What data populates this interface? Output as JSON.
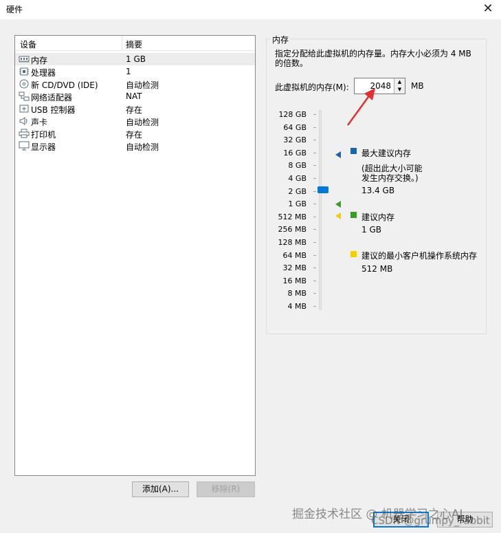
{
  "window": {
    "title": "硬件",
    "close_glyph": "✕"
  },
  "device_list": {
    "headers": [
      "设备",
      "摘要"
    ],
    "rows": [
      {
        "icon": "memory-icon",
        "name": "内存",
        "summary": "1 GB"
      },
      {
        "icon": "processor-icon",
        "name": "处理器",
        "summary": "1"
      },
      {
        "icon": "cd-dvd-icon",
        "name": "新 CD/DVD (IDE)",
        "summary": "自动检测"
      },
      {
        "icon": "network-adapter-icon",
        "name": "网络适配器",
        "summary": "NAT"
      },
      {
        "icon": "usb-icon",
        "name": "USB 控制器",
        "summary": "存在"
      },
      {
        "icon": "sound-card-icon",
        "name": "声卡",
        "summary": "自动检测"
      },
      {
        "icon": "printer-icon",
        "name": "打印机",
        "summary": "存在"
      },
      {
        "icon": "display-icon",
        "name": "显示器",
        "summary": "自动检测"
      }
    ],
    "selected_index": 0
  },
  "buttons": {
    "add": "添加(A)...",
    "remove": "移除(R)",
    "close": "关闭",
    "help": "帮助"
  },
  "memory": {
    "group_title": "内存",
    "description": "指定分配给此虚拟机的内存量。内存大小必须为 4 MB 的倍数。",
    "field_label": "此虚拟机的内存(M):",
    "value": "2048",
    "unit": "MB",
    "scale": [
      "128 GB",
      "64 GB",
      "32 GB",
      "16 GB",
      "8 GB",
      "4 GB",
      "2 GB",
      "1 GB",
      "512 MB",
      "256 MB",
      "128 MB",
      "64 MB",
      "32 MB",
      "16 MB",
      "8 MB",
      "4 MB"
    ],
    "slider_level": "2 GB",
    "legend": {
      "max_title": "最大建议内存",
      "max_note_1": "(超出此大小可能",
      "max_note_2": "发生内存交换。)",
      "max_value": "13.4 GB",
      "rec_title": "建议内存",
      "rec_value": "1 GB",
      "min_title": "建议的最小客户机操作系统内存",
      "min_value": "512 MB"
    },
    "colors": {
      "max": "#1a64a8",
      "recommended": "#3c9a28",
      "minimum": "#f0d000",
      "slider": "#0078d7"
    }
  },
  "annotation": {
    "arrow_color": "#e03030"
  },
  "watermark": {
    "line1": "掘金技术社区 @ 机器学习之心AI",
    "line2": "CSDN @grumpy_rabbit"
  }
}
